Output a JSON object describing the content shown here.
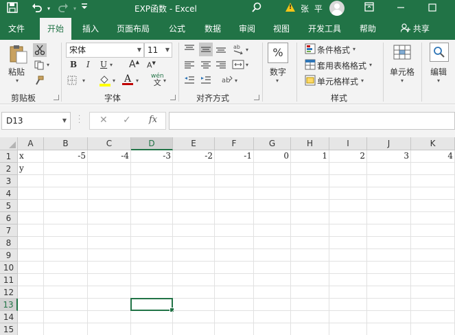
{
  "titlebar": {
    "title": "EXP函数  -  Excel",
    "user": "张 平"
  },
  "tabs": [
    {
      "label": "文件"
    },
    {
      "label": "开始"
    },
    {
      "label": "插入"
    },
    {
      "label": "页面布局"
    },
    {
      "label": "公式"
    },
    {
      "label": "数据"
    },
    {
      "label": "审阅"
    },
    {
      "label": "视图"
    },
    {
      "label": "开发工具"
    },
    {
      "label": "帮助"
    }
  ],
  "share_label": "共享",
  "ribbon": {
    "clipboard": {
      "paste_label": "粘贴",
      "group_label": "剪贴板"
    },
    "font": {
      "font_name": "宋体",
      "font_size": "11",
      "bold": "B",
      "italic": "I",
      "underline": "U",
      "grow": "A",
      "shrink": "A",
      "wen": "wén",
      "wen_char": "文",
      "group_label": "字体"
    },
    "alignment": {
      "group_label": "对齐方式"
    },
    "number": {
      "format_label": "数字",
      "percent": "%"
    },
    "styles": {
      "conditional": "条件格式",
      "table": "套用表格格式",
      "cell_styles": "单元格样式",
      "group_label": "样式"
    },
    "cells": {
      "label": "单元格"
    },
    "editing": {
      "label": "编辑"
    }
  },
  "formula_bar": {
    "name_box": "D13",
    "fx": "fx",
    "value": ""
  },
  "grid": {
    "columns": [
      "A",
      "B",
      "C",
      "D",
      "E",
      "F",
      "G",
      "H",
      "I",
      "J",
      "K"
    ],
    "rows": [
      "1",
      "2",
      "3",
      "4",
      "5",
      "6",
      "7",
      "8",
      "9",
      "10",
      "11",
      "12",
      "13",
      "14",
      "15"
    ],
    "selected_column": "D",
    "selected_row": "13",
    "cells": {
      "A1": "x",
      "A2": "y",
      "B1": "-5",
      "C1": "-4",
      "D1": "-3",
      "E1": "-2",
      "F1": "-1",
      "G1": "0",
      "H1": "1",
      "I1": "2",
      "J1": "3",
      "K1": "4"
    }
  },
  "colors": {
    "accent": "#217346",
    "ribbon_bg": "#f3f3f3",
    "header_bg": "#e6e6e6",
    "fill_yellow": "#ffff00",
    "font_red": "#c00000"
  },
  "icons": [
    "save-icon",
    "undo-icon",
    "redo-icon",
    "customize-icon",
    "search-icon",
    "warning-icon",
    "avatar",
    "ribbon-display-icon",
    "minimize-icon",
    "maximize-icon",
    "share-icon"
  ]
}
